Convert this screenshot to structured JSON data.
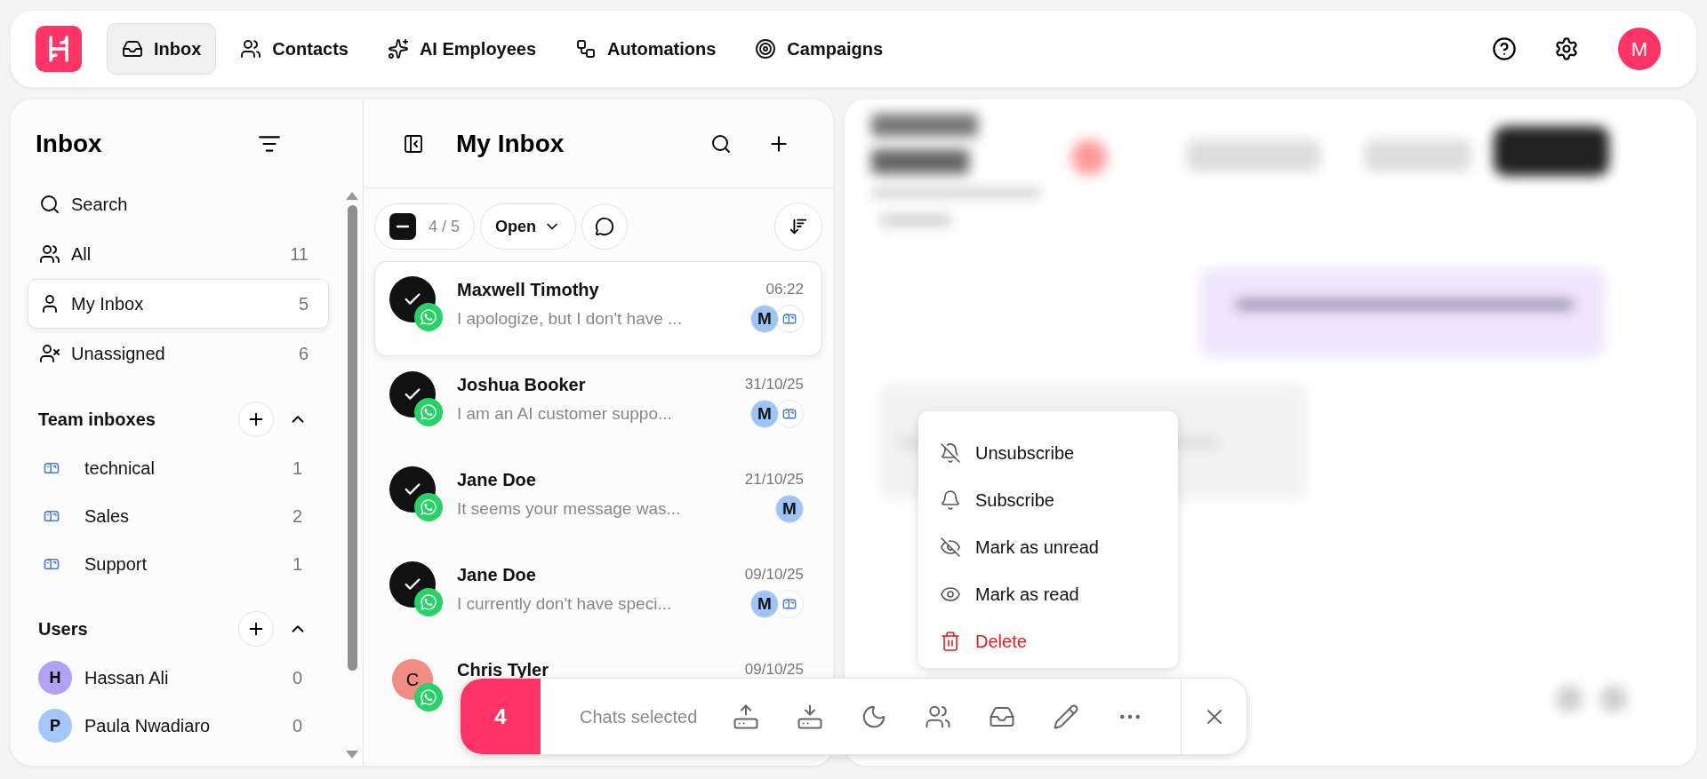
{
  "nav": {
    "tabs": [
      {
        "label": "Inbox",
        "selected": true
      },
      {
        "label": "Contacts",
        "selected": false
      },
      {
        "label": "AI Employees",
        "selected": false
      },
      {
        "label": "Automations",
        "selected": false
      },
      {
        "label": "Campaigns",
        "selected": false
      }
    ],
    "avatar": "M"
  },
  "sidebar": {
    "title": "Inbox",
    "items": [
      {
        "label": "Search",
        "selected": false
      },
      {
        "label": "All",
        "count": "11",
        "selected": false
      },
      {
        "label": "My Inbox",
        "count": "5",
        "selected": true
      },
      {
        "label": "Unassigned",
        "count": "6",
        "selected": false
      }
    ],
    "sections": [
      {
        "kind": "team",
        "title": "Team inboxes",
        "expanded": true,
        "items": [
          {
            "label": "technical",
            "count": "1"
          },
          {
            "label": "Sales",
            "count": "2"
          },
          {
            "label": "Support",
            "count": "1"
          }
        ]
      },
      {
        "kind": "users",
        "title": "Users",
        "expanded": true,
        "items": [
          {
            "label": "Hassan Ali",
            "count": "0",
            "avatar": "H",
            "color": "#b3a1f5"
          },
          {
            "label": "Paula Nwadiaro",
            "count": "0",
            "avatar": "P",
            "color": "#a3c8f7"
          }
        ]
      }
    ]
  },
  "chat_list": {
    "title": "My Inbox",
    "selection_count": "4 / 5",
    "status": "Open",
    "chats": [
      {
        "name": "Maxwell Timothy",
        "time": "06:22",
        "preview": "I apologize, but I don't have ...",
        "checked": true,
        "selected": true,
        "assignee": "M",
        "team_inbox": true
      },
      {
        "name": "Joshua Booker",
        "time": "31/10/25",
        "preview": "I am an AI customer suppo...",
        "checked": true,
        "selected": false,
        "assignee": "M",
        "team_inbox": true
      },
      {
        "name": "Jane Doe",
        "time": "21/10/25",
        "preview": "It seems your message was...",
        "checked": true,
        "selected": false,
        "assignee": "M",
        "team_inbox": false
      },
      {
        "name": "Jane Doe",
        "time": "09/10/25",
        "preview": "I currently don't have speci...",
        "checked": true,
        "selected": false,
        "assignee": "M",
        "team_inbox": true
      },
      {
        "name": "Chris Tyler",
        "time": "09/10/25",
        "checked": false,
        "selected": false,
        "avatar": "C",
        "color": "#f28b82"
      }
    ]
  },
  "bulk_bar": {
    "count": "4",
    "label": "Chats selected"
  },
  "menu": {
    "items": [
      {
        "label": "Unsubscribe",
        "kind": "normal"
      },
      {
        "label": "Subscribe",
        "kind": "normal"
      },
      {
        "label": "Mark as unread",
        "kind": "normal"
      },
      {
        "label": "Mark as read",
        "kind": "normal"
      },
      {
        "label": "Delete",
        "kind": "danger"
      }
    ]
  }
}
